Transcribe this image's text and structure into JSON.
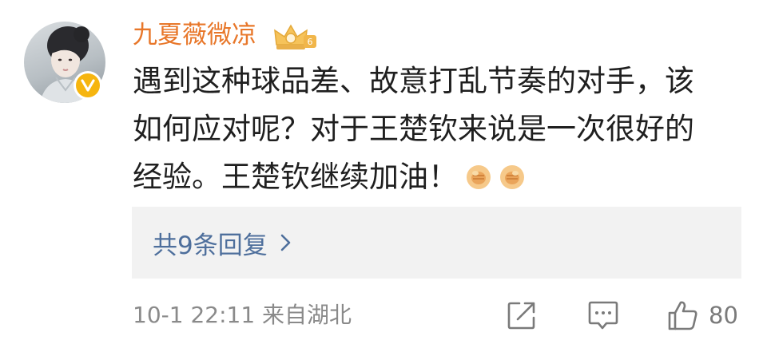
{
  "comment": {
    "username": "九夏薇微凉",
    "text_line1": "遇到这种球品差、故意打乱节奏的对手，该",
    "text_line2": "如何应对呢？对于王楚钦来说是一次很好的",
    "text_line3": "经验。王楚钦继续加油！",
    "emojis": [
      "fist-emoji",
      "fist-emoji"
    ],
    "vip_icon": "vip-crown-icon",
    "verified_badge": "verified-v-icon"
  },
  "replies": {
    "label": "共9条回复",
    "chevron_icon": "chevron-right-icon"
  },
  "footer": {
    "time_location": "10-1 22:11  来自湖北",
    "share_icon": "share-icon",
    "comment_icon": "comment-icon",
    "like_icon": "like-icon",
    "like_count": "80"
  },
  "colors": {
    "username": "#e8772a",
    "reply_link": "#4e6f9c",
    "reply_bg": "#f2f2f2",
    "verified": "#f6b50f"
  }
}
